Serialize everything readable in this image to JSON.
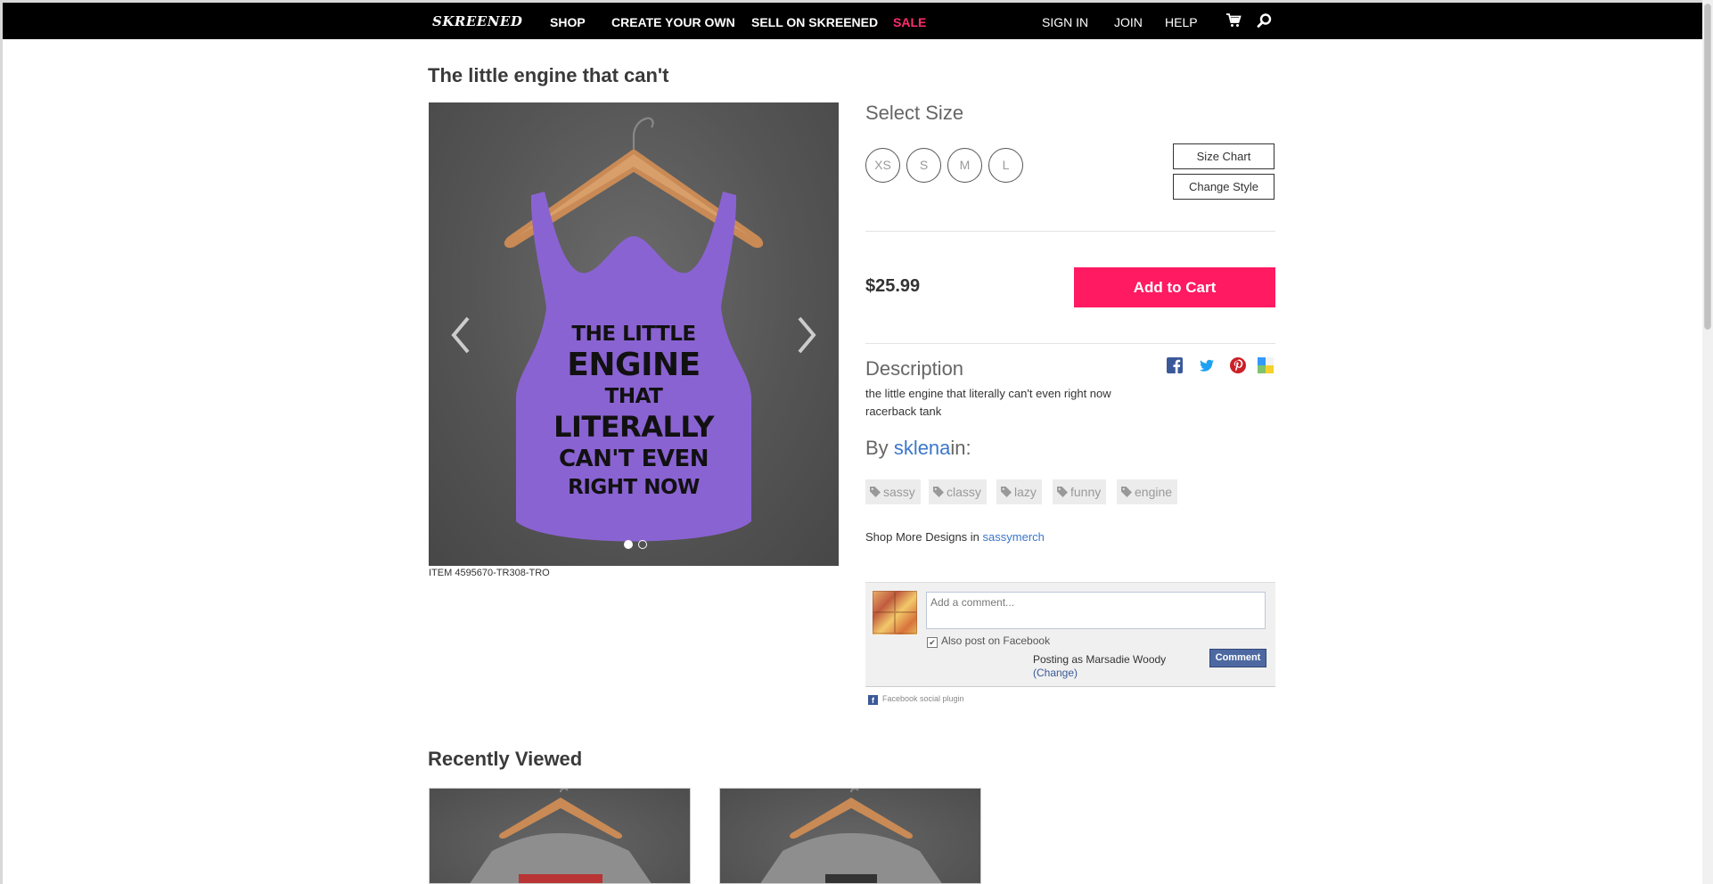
{
  "nav": {
    "logo": "SKREENED",
    "links": [
      "SHOP",
      "CREATE YOUR OWN",
      "SELL ON SKREENED",
      "SALE"
    ],
    "right_links": [
      "SIGN IN",
      "JOIN",
      "HELP"
    ],
    "icons": [
      "cart-icon",
      "search-icon"
    ]
  },
  "product": {
    "title": "The little engine that can't",
    "item_id": "ITEM 4595670-TR308-TRO",
    "shirt_text": [
      "THE LITTLE",
      "ENGINE",
      "THAT",
      "LITERALLY",
      "CAN'T EVEN",
      "RIGHT NOW"
    ],
    "shirt_color": "#8a63d2",
    "slide_count": 2,
    "active_slide": 1
  },
  "options": {
    "select_size_label": "Select Size",
    "sizes": [
      "XS",
      "S",
      "M",
      "L"
    ],
    "size_chart_label": "Size Chart",
    "change_style_label": "Change Style"
  },
  "purchase": {
    "price": "$25.99",
    "add_to_cart_label": "Add to Cart",
    "accent_color": "#ff1a62"
  },
  "description": {
    "heading": "Description",
    "text": "the little engine that literally can't even right now racerback tank",
    "share_icons": [
      "facebook-icon",
      "twitter-icon",
      "pinterest-icon",
      "delicious-icon"
    ]
  },
  "author": {
    "by_label": "By",
    "name": "sklena",
    "in_label": "in:"
  },
  "tags": [
    "sassy",
    "classy",
    "lazy",
    "funny",
    "engine"
  ],
  "shop_more": {
    "label": "Shop More Designs in",
    "store": "sassymerch"
  },
  "facebook_comments": {
    "placeholder": "Add a comment...",
    "also_post_label": "Also post on Facebook",
    "also_post_checked": true,
    "posting_as": "Posting as Marsadie Woody",
    "change_label": "(Change)",
    "comment_button": "Comment",
    "plugin_label": "Facebook social plugin"
  },
  "recently_viewed": {
    "heading": "Recently Viewed",
    "item_count": 2
  }
}
